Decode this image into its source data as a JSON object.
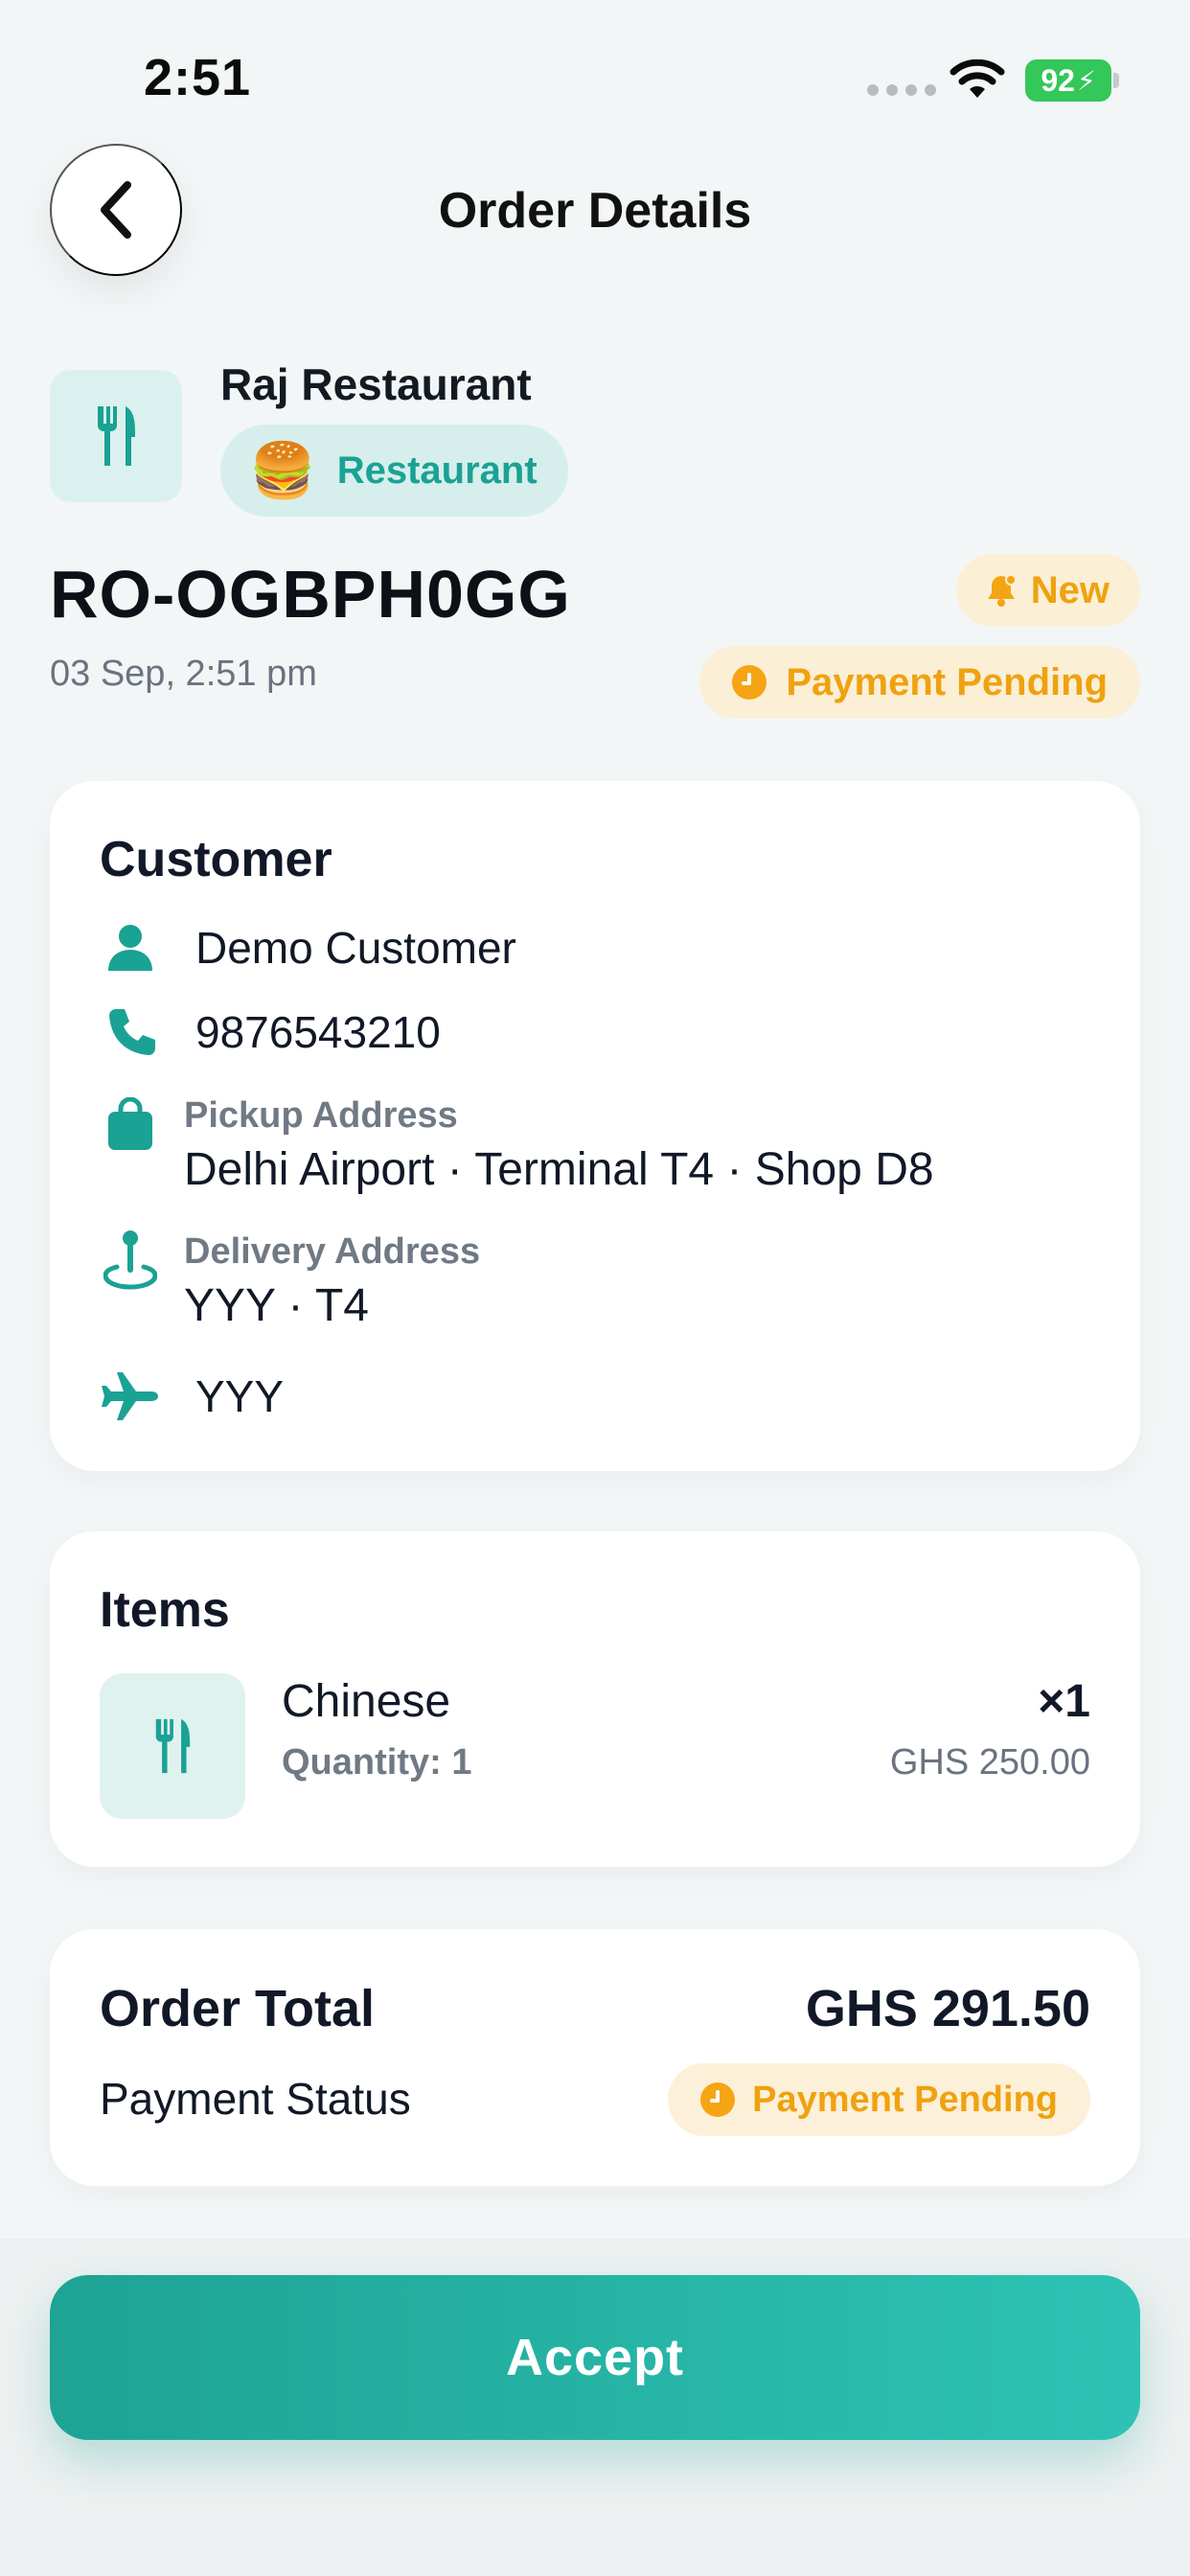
{
  "status_bar": {
    "time": "2:51",
    "battery": "92"
  },
  "header": {
    "title": "Order Details"
  },
  "merchant": {
    "name": "Raj Restaurant",
    "tag_emoji": "🍔",
    "tag_label": "Restaurant"
  },
  "order": {
    "id": "RO-OGBPH0GG",
    "date": "03 Sep, 2:51 pm",
    "status_badge": "New",
    "payment_badge": "Payment Pending"
  },
  "customer": {
    "title": "Customer",
    "name": "Demo Customer",
    "phone": "9876543210",
    "pickup_label": "Pickup Address",
    "pickup_value": "Delhi Airport · Terminal T4 · Shop D8",
    "delivery_label": "Delivery Address",
    "delivery_value": "YYY · T4",
    "flight": "YYY"
  },
  "items": {
    "title": "Items",
    "list": [
      {
        "name": "Chinese",
        "quantity": "Quantity: 1",
        "multiplier": "×1",
        "price": "GHS 250.00"
      }
    ]
  },
  "totals": {
    "total_label": "Order Total",
    "total_value": "GHS 291.50",
    "payment_status_label": "Payment Status",
    "payment_status_value": "Payment Pending"
  },
  "actions": {
    "accept_label": "Accept"
  },
  "colors": {
    "accent": "#1ea394",
    "warning": "#efa20f",
    "warning_bg": "#fbefd6"
  }
}
